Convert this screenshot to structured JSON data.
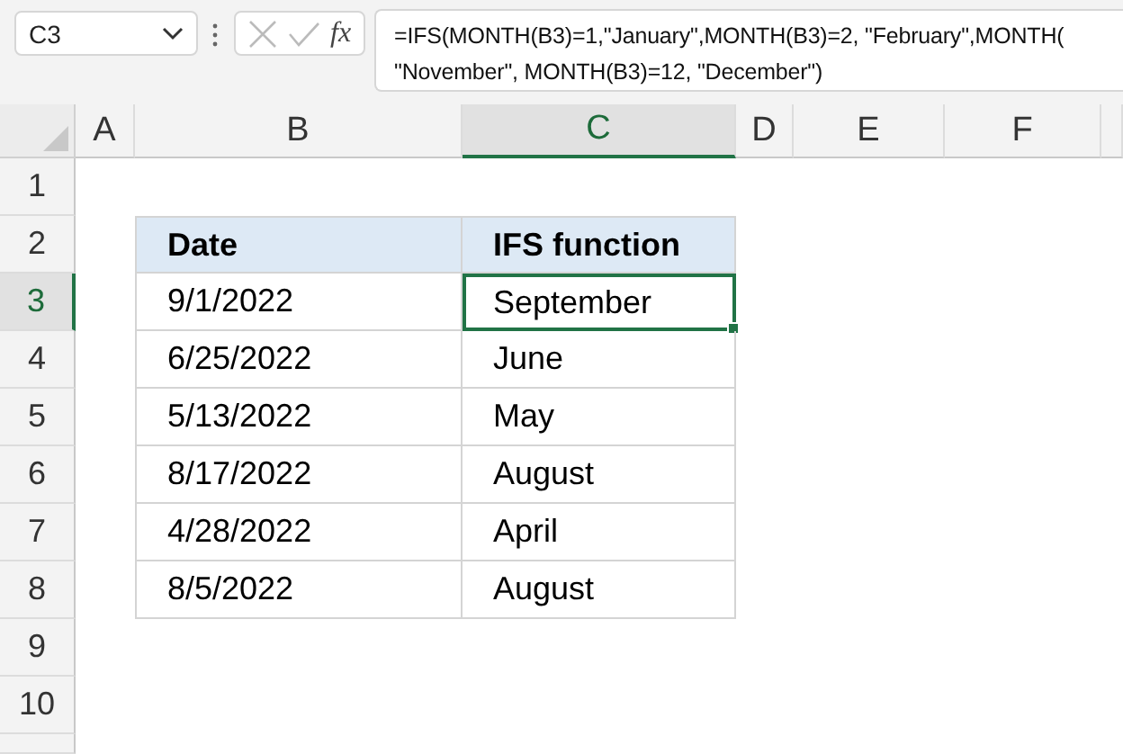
{
  "name_box": {
    "value": "C3"
  },
  "function_button": {
    "label": "fx"
  },
  "formula_bar": {
    "lines": [
      "=IFS(MONTH(B3)=1,\"January\",MONTH(B3)=2, \"February\",MONTH(",
      "\"November\", MONTH(B3)=12, \"December\")"
    ]
  },
  "columns": [
    {
      "label": "A",
      "selected": false
    },
    {
      "label": "B",
      "selected": false
    },
    {
      "label": "C",
      "selected": true
    },
    {
      "label": "D",
      "selected": false
    },
    {
      "label": "E",
      "selected": false
    },
    {
      "label": "F",
      "selected": false
    }
  ],
  "rows": [
    {
      "number": "1",
      "selected": false,
      "kind": "blank"
    },
    {
      "number": "2",
      "selected": false,
      "kind": "header",
      "column_b": "Date",
      "column_c": "IFS function"
    },
    {
      "number": "3",
      "selected": true,
      "kind": "data",
      "column_b": "9/1/2022",
      "column_c": "September"
    },
    {
      "number": "4",
      "selected": false,
      "kind": "data",
      "column_b": "6/25/2022",
      "column_c": "June"
    },
    {
      "number": "5",
      "selected": false,
      "kind": "data",
      "column_b": "5/13/2022",
      "column_c": "May"
    },
    {
      "number": "6",
      "selected": false,
      "kind": "data",
      "column_b": "8/17/2022",
      "column_c": "August"
    },
    {
      "number": "7",
      "selected": false,
      "kind": "data",
      "column_b": "4/28/2022",
      "column_c": "April"
    },
    {
      "number": "8",
      "selected": false,
      "kind": "data",
      "column_b": "8/5/2022",
      "column_c": "August"
    },
    {
      "number": "9",
      "selected": false,
      "kind": "blank"
    },
    {
      "number": "10",
      "selected": false,
      "kind": "blank"
    }
  ]
}
